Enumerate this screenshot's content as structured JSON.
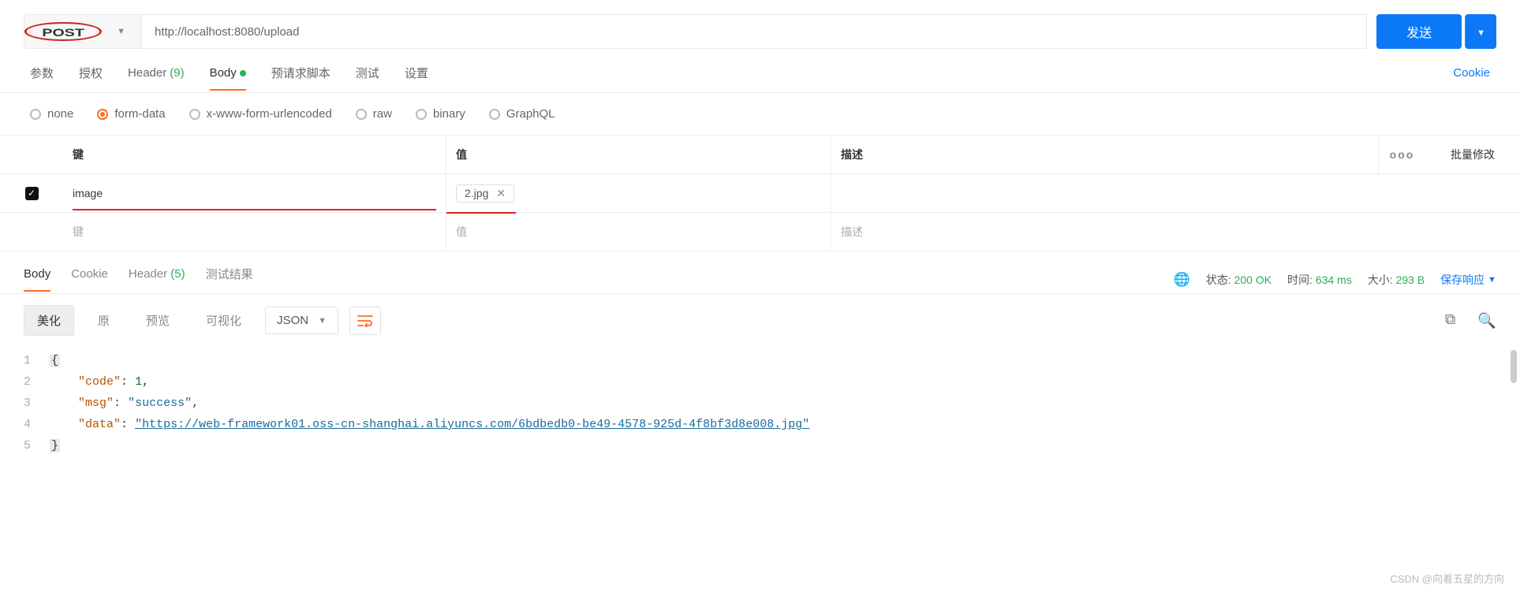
{
  "request": {
    "method": "POST",
    "url": "http://localhost:8080/upload",
    "send_label": "发送"
  },
  "main_tabs": {
    "params": "参数",
    "auth": "授权",
    "header": "Header",
    "header_count": "(9)",
    "body": "Body",
    "preReq": "预请求脚本",
    "tests": "测试",
    "settings": "设置",
    "cookie": "Cookie"
  },
  "body_types": {
    "none": "none",
    "form_data": "form-data",
    "urlencoded": "x-www-form-urlencoded",
    "raw": "raw",
    "binary": "binary",
    "graphql": "GraphQL",
    "selected": "form-data"
  },
  "form_headers": {
    "key": "键",
    "value": "值",
    "desc": "描述",
    "dots": "ooo",
    "batch": "批量修改"
  },
  "form_rows": [
    {
      "checked": true,
      "key": "image",
      "file": "2.jpg",
      "desc": ""
    }
  ],
  "form_placeholders": {
    "key": "键",
    "value": "值",
    "desc": "描述"
  },
  "resp_tabs": {
    "body": "Body",
    "cookie": "Cookie",
    "header": "Header",
    "header_count": "(5)",
    "test": "测试结果"
  },
  "resp_meta": {
    "status_label": "状态:",
    "status_value": "200 OK",
    "time_label": "时间:",
    "time_value": "634 ms",
    "size_label": "大小:",
    "size_value": "293 B",
    "save": "保存响应"
  },
  "resp_toolbar": {
    "pretty": "美化",
    "raw": "原",
    "preview": "预览",
    "visualize": "可视化",
    "format": "JSON"
  },
  "response_json": {
    "lines": [
      "1",
      "2",
      "3",
      "4",
      "5"
    ],
    "code_key": "\"code\"",
    "code_val": "1",
    "msg_key": "\"msg\"",
    "msg_val": "\"success\"",
    "data_key": "\"data\"",
    "data_val": "\"https://web-framework01.oss-cn-shanghai.aliyuncs.com/6bdbedb0-be49-4578-925d-4f8bf3d8e008.jpg\""
  },
  "watermark": "CSDN @向着五星的方向"
}
